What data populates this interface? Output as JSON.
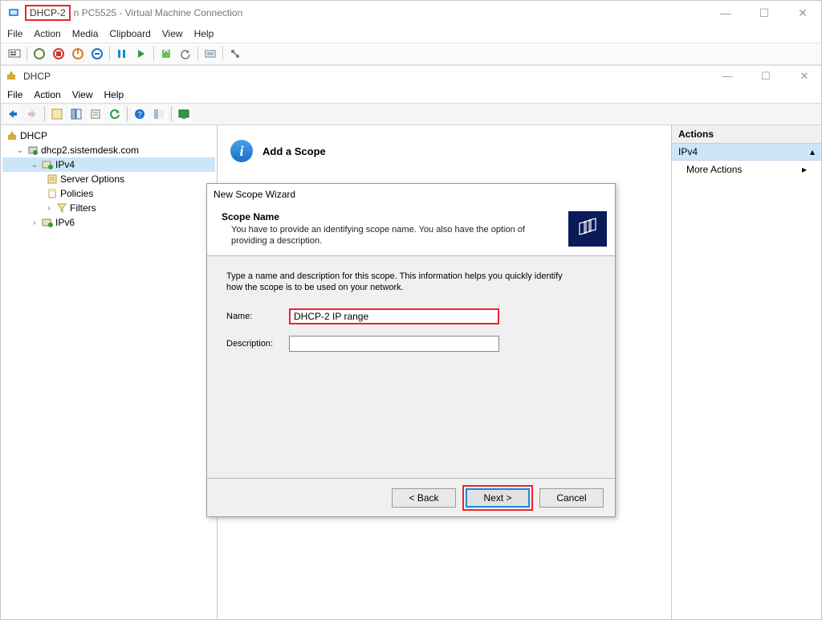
{
  "vm": {
    "title_prefix": "DHCP-2",
    "title_suffix": "n PC5525 - Virtual Machine Connection",
    "menu": [
      "File",
      "Action",
      "Media",
      "Clipboard",
      "View",
      "Help"
    ]
  },
  "mmc": {
    "title": "DHCP",
    "menu": [
      "File",
      "Action",
      "View",
      "Help"
    ]
  },
  "tree": {
    "root": "DHCP",
    "server": "dhcp2.sistemdesk.com",
    "ipv4": "IPv4",
    "server_options": "Server Options",
    "policies": "Policies",
    "filters": "Filters",
    "ipv6": "IPv6"
  },
  "content": {
    "header_title": "Add a Scope"
  },
  "wizard": {
    "title": "New Scope Wizard",
    "heading": "Scope Name",
    "sub": "You have to provide an identifying scope name. You also have the option of providing a description.",
    "intro": "Type a name and description for this scope. This information helps you quickly identify how the scope is to be used on your network.",
    "name_label": "Name:",
    "name_value": "DHCP-2 IP range",
    "desc_label": "Description:",
    "desc_value": "",
    "back": "< Back",
    "next": "Next >",
    "cancel": "Cancel"
  },
  "actions": {
    "title": "Actions",
    "section": "IPv4",
    "more": "More Actions"
  }
}
